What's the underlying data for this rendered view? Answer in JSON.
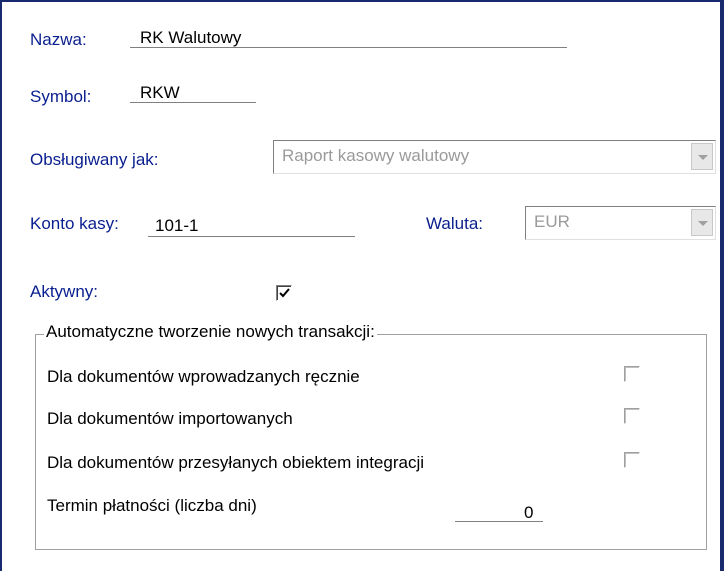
{
  "form": {
    "nazwa_label": "Nazwa:",
    "nazwa_value": "RK Walutowy",
    "symbol_label": "Symbol:",
    "symbol_value": "RKW",
    "obslugiwany_label": "Obsługiwany jak:",
    "obslugiwany_value": "Raport kasowy walutowy",
    "konto_label": "Konto kasy:",
    "konto_value": "101-1",
    "waluta_label": "Waluta:",
    "waluta_value": "EUR",
    "aktywny_label": "Aktywny:",
    "aktywny_checked": true
  },
  "group": {
    "title": "Automatyczne tworzenie nowych transakcji:",
    "items": [
      {
        "label": "Dla dokumentów wprowadzanych ręcznie",
        "checked": false
      },
      {
        "label": "Dla dokumentów importowanych",
        "checked": false
      },
      {
        "label": "Dla dokumentów przesyłanych obiektem integracji",
        "checked": false
      }
    ],
    "termin_label": "Termin płatności (liczba dni)",
    "termin_value": "0"
  },
  "icons": {
    "combo_arrow": "chevron-down-icon",
    "check": "checkmark-icon"
  },
  "colors": {
    "label_blue": "#0a1f8f",
    "frame": "#1a2a6e",
    "disabled_text": "#9a9a9a"
  }
}
